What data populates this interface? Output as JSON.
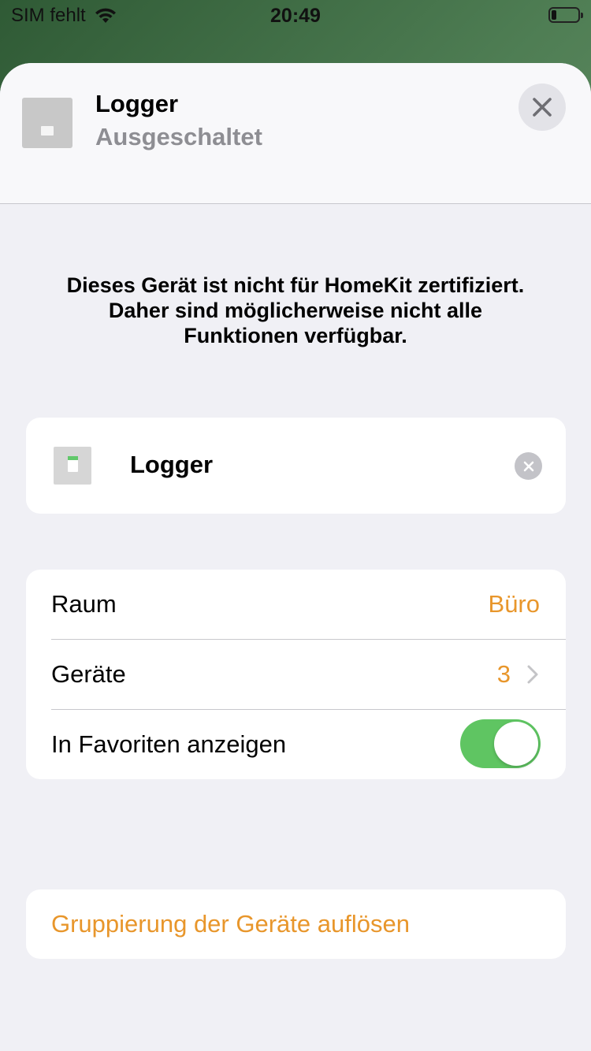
{
  "status_bar": {
    "carrier": "SIM fehlt",
    "time": "20:49",
    "icons": [
      "wifi-icon",
      "battery-icon"
    ]
  },
  "header": {
    "title": "Logger",
    "subtitle": "Ausgeschaltet",
    "icon": "switch-icon",
    "close_icon": "close-icon"
  },
  "notice": {
    "text": "Dieses Gerät ist nicht für HomeKit zertifiziert. Daher sind möglicherweise nicht alle Funktionen verfügbar."
  },
  "device": {
    "name": "Logger",
    "icon": "switch-icon",
    "clear_icon": "clear-icon"
  },
  "settings": {
    "room_label": "Raum",
    "room_value": "Büro",
    "devices_label": "Geräte",
    "devices_count": "3",
    "favorites_label": "In Favoriten anzeigen",
    "favorites_on": true
  },
  "action": {
    "ungroup_label": "Gruppierung der Geräte auflösen"
  },
  "colors": {
    "accent": "#e8962b",
    "toggle_on": "#5fc562",
    "background": "#f0f0f5"
  }
}
